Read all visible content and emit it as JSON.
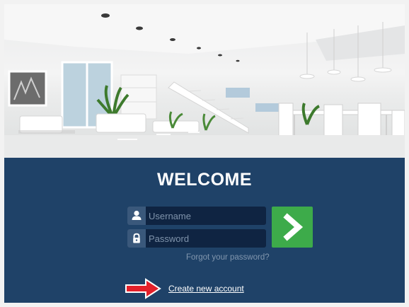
{
  "hero": {
    "description_icon": "hero-interior-image"
  },
  "login": {
    "title": "WELCOME",
    "username_placeholder": "Username",
    "password_placeholder": "Password",
    "forgot_link": "Forgot your password?",
    "create_link": "Create new account",
    "submit_icon": "chevron-right-icon",
    "user_icon": "user-icon",
    "lock_icon": "lock-icon",
    "annotation_icon": "red-arrow-icon"
  },
  "colors": {
    "panel_bg": "#1f4268",
    "field_bg": "#0f2442",
    "icon_bg": "#3a587b",
    "submit_bg": "#3dab4a",
    "arrow": "#e3202a"
  }
}
